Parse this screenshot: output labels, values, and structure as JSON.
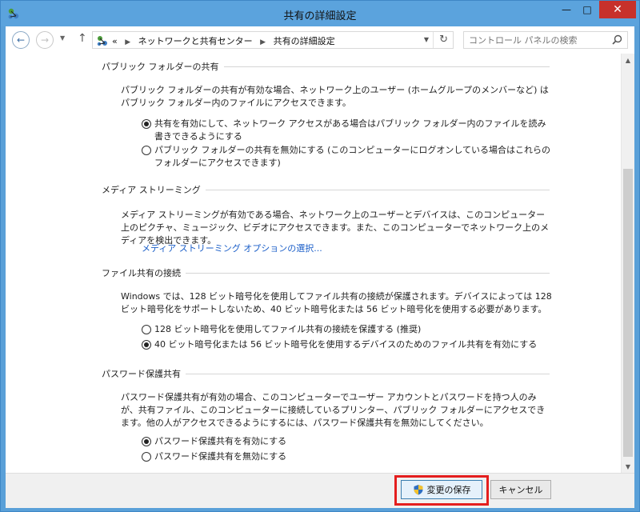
{
  "window": {
    "title": "共有の詳細設定",
    "controls": {
      "minimize": "—",
      "maximize": "□",
      "close": "✕"
    }
  },
  "nav": {
    "breadcrumb": {
      "prefix": "«",
      "items": [
        "ネットワークと共有センター",
        "共有の詳細設定"
      ]
    },
    "search_placeholder": "コントロール パネルの検索"
  },
  "sections": {
    "public_folder": {
      "title": "パブリック フォルダーの共有",
      "description": "パブリック フォルダーの共有が有効な場合、ネットワーク上のユーザー (ホームグループのメンバーなど) はパブリック フォルダー内のファイルにアクセスできます。",
      "options": [
        {
          "label": "共有を有効にして、ネットワーク アクセスがある場合はパブリック フォルダー内のファイルを読み書きできるようにする",
          "checked": true
        },
        {
          "label": "パブリック フォルダーの共有を無効にする (このコンピューターにログオンしている場合はこれらのフォルダーにアクセスできます)",
          "checked": false
        }
      ]
    },
    "media_streaming": {
      "title": "メディア ストリーミング",
      "description": "メディア ストリーミングが有効である場合、ネットワーク上のユーザーとデバイスは、このコンピューター上のピクチャ、ミュージック、ビデオにアクセスできます。また、このコンピューターでネットワーク上のメディアを検出できます。",
      "link": "メディア ストリーミング オプションの選択..."
    },
    "file_sharing": {
      "title": "ファイル共有の接続",
      "description": "Windows では、128 ビット暗号化を使用してファイル共有の接続が保護されます。デバイスによっては 128 ビット暗号化をサポートしないため、40 ビット暗号化または 56 ビット暗号化を使用する必要があります。",
      "options": [
        {
          "label": "128 ビット暗号化を使用してファイル共有の接続を保護する (推奨)",
          "checked": false
        },
        {
          "label": "40 ビット暗号化または 56 ビット暗号化を使用するデバイスのためのファイル共有を有効にする",
          "checked": true
        }
      ]
    },
    "password_sharing": {
      "title": "パスワード保護共有",
      "description": "パスワード保護共有が有効の場合、このコンピューターでユーザー アカウントとパスワードを持つ人のみが、共有ファイル、このコンピューターに接続しているプリンター、パブリック フォルダーにアクセスできます。他の人がアクセスできるようにするには、パスワード保護共有を無効にしてください。",
      "options": [
        {
          "label": "パスワード保護共有を有効にする",
          "checked": true
        },
        {
          "label": "パスワード保護共有を無効にする",
          "checked": false
        }
      ]
    }
  },
  "footer": {
    "save_label": "変更の保存",
    "cancel_label": "キャンセル"
  }
}
